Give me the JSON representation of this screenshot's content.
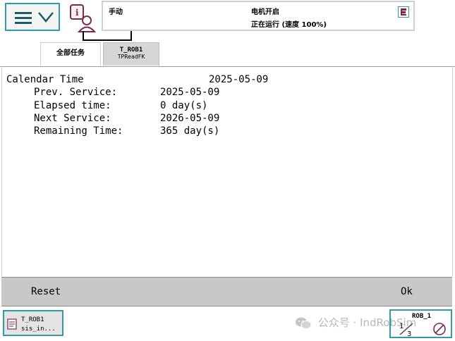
{
  "header": {
    "operating_mode": "手动",
    "motor_state": "电机开启",
    "run_state": "正在运行 (速度 100%)"
  },
  "tabs": [
    {
      "label": "全部任务"
    },
    {
      "label": "T_ROB1",
      "sublabel": "TPReadFK"
    }
  ],
  "content": {
    "lines": [
      {
        "label": "Calendar Time",
        "value": "2025-05-09"
      },
      {
        "label": "Prev. Service:",
        "value": "2025-05-09"
      },
      {
        "label": "Elapsed time:",
        "value": "0 day(s)"
      },
      {
        "label": "Next Service:",
        "value": "2026-05-09"
      },
      {
        "label": "Remaining Time:",
        "value": "365 day(s)"
      }
    ]
  },
  "commandbar": {
    "reset_label": "Reset",
    "ok_label": "Ok"
  },
  "taskbar": {
    "task_line1": "T_ROB1",
    "task_line2": "sis_in...",
    "watermark": "公众号 · IndRobSim",
    "quickset_robot": "ROB_1",
    "quickset_fraction": "1/3"
  },
  "colors": {
    "accent": "#2f9aa8",
    "command_bar": "#c8c8c8",
    "tab_active": "#d6d6d6"
  },
  "icons": {
    "menu": "hamburger-menu-icon",
    "menu_chevron": "chevron-down-icon",
    "status": "info-operator-icon",
    "stop": "program-stop-icon",
    "task": "program-window-icon",
    "wechat": "wechat-icon",
    "quickset_run": "run-mode-icon"
  }
}
